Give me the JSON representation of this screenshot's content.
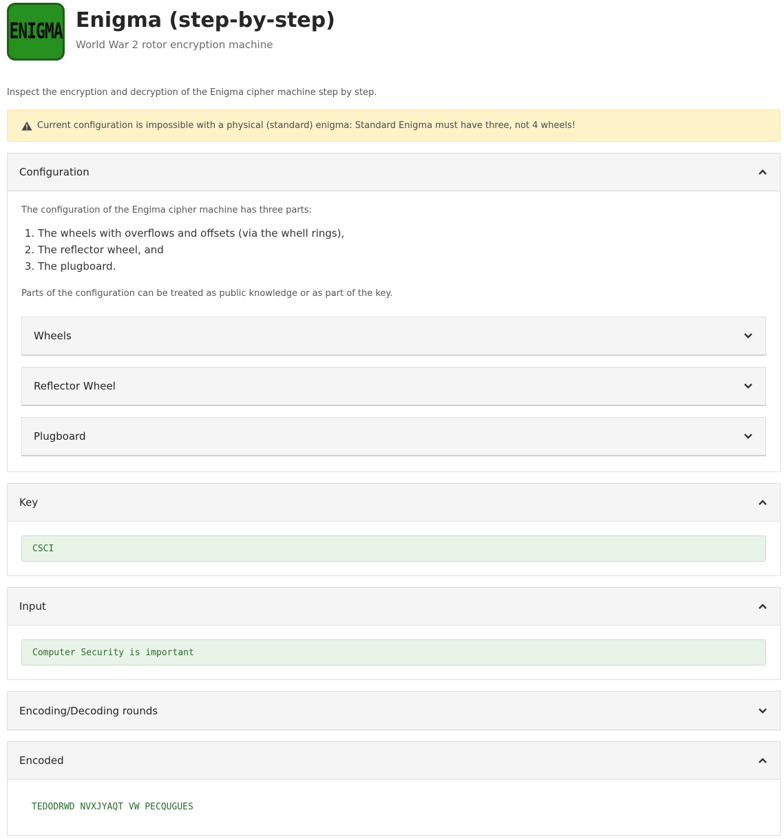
{
  "app": {
    "logo_text": "ENIGMA",
    "title": "Enigma (step-by-step)",
    "subtitle": "World War 2 rotor encryption machine"
  },
  "intro": "Inspect the encryption and decryption of the Enigma cipher machine step by step.",
  "warning": {
    "icon": "warning-triangle-icon",
    "text": "Current configuration is impossible with a physical (standard) enigma: Standard Enigma must have three, not 4 wheels!"
  },
  "configuration": {
    "title": "Configuration",
    "description": "The configuration of the Engima cipher machine has three parts:",
    "parts": [
      "The wheels with overflows and offsets (via the whell rings),",
      "The reflector wheel, and",
      "The plugboard."
    ],
    "note": "Parts of the configuration can be treated as public knowledge or as part of the key.",
    "sections": [
      {
        "label": "Wheels"
      },
      {
        "label": "Reflector Wheel"
      },
      {
        "label": "Plugboard"
      }
    ]
  },
  "key": {
    "title": "Key",
    "value": "CSCI"
  },
  "input": {
    "title": "Input",
    "value": "Computer Security is important"
  },
  "rounds": {
    "title": "Encoding/Decoding rounds"
  },
  "encoded": {
    "title": "Encoded",
    "value": "TEDODRWD NVXJYAQT VW PECQUGUES"
  },
  "colors": {
    "logo_bg": "#26911f",
    "warning_bg": "#fdf2c8",
    "field_bg": "#e9f4e8",
    "field_text": "#2d6a2d"
  }
}
